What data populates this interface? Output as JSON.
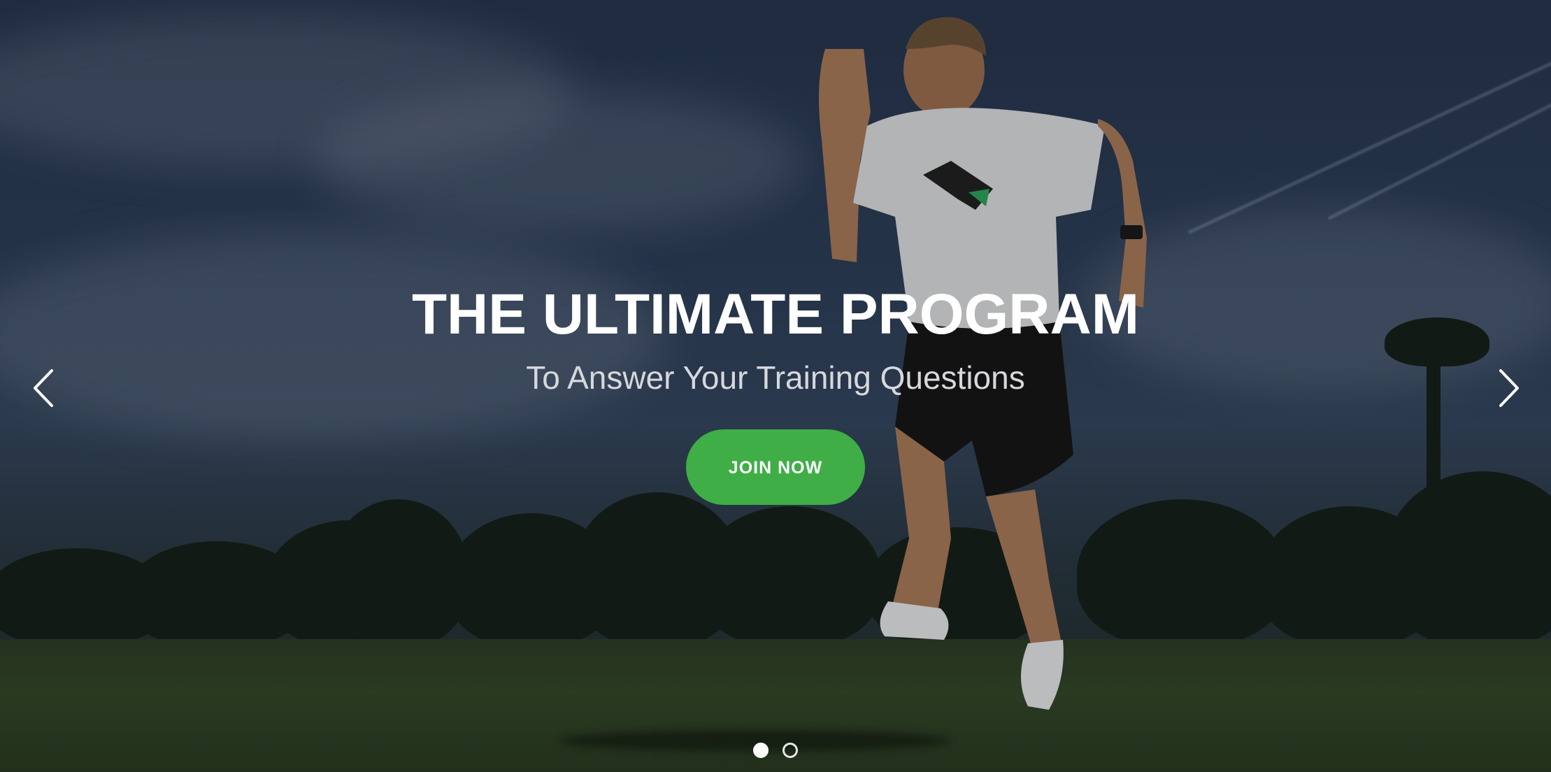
{
  "hero": {
    "title": "THE ULTIMATE PROGRAM",
    "subtitle": "To Answer Your Training Questions",
    "cta_label": "JOIN NOW",
    "accent_color": "#3fae46"
  },
  "carousel": {
    "prev_icon": "chevron-left-icon",
    "next_icon": "chevron-right-icon",
    "slide_count": 2,
    "active_slide": 1
  }
}
